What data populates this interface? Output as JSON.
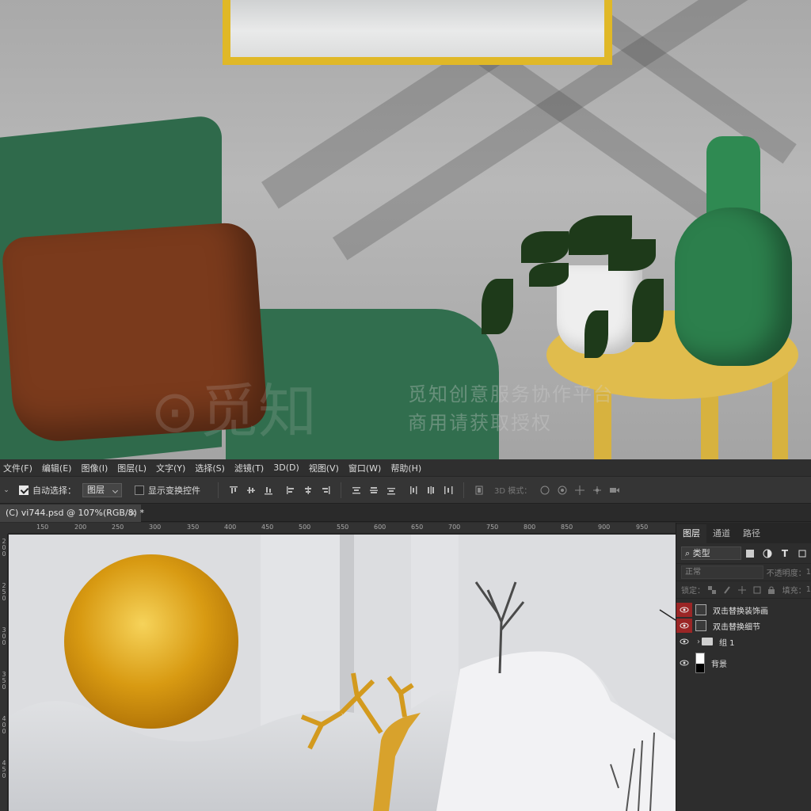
{
  "watermark": {
    "line1": "觅知创意服务协作平台",
    "line2": "商用请获取授权"
  },
  "menu": [
    "文件(F)",
    "编辑(E)",
    "图像(I)",
    "图层(L)",
    "文字(Y)",
    "选择(S)",
    "滤镜(T)",
    "3D(D)",
    "视图(V)",
    "窗口(W)",
    "帮助(H)"
  ],
  "options_bar": {
    "auto_select_label": "自动选择：",
    "auto_select_checked": true,
    "auto_select_value": "图层",
    "transform_controls_label": "显示变换控件",
    "transform_controls_checked": false,
    "mode3d_label": "3D 模式："
  },
  "document_tab": {
    "title": "(C) vi744.psd @ 107%(RGB/8) *",
    "close": "×"
  },
  "ruler": {
    "horizontal": [
      "150",
      "200",
      "250",
      "300",
      "350",
      "400",
      "450",
      "500",
      "550",
      "600",
      "650",
      "700",
      "750",
      "800",
      "850",
      "900",
      "950"
    ],
    "vertical": [
      "2",
      "0",
      "0",
      "2",
      "5",
      "0",
      "3",
      "0",
      "0",
      "3",
      "5",
      "0",
      "4",
      "0",
      "0",
      "4",
      "5",
      "0"
    ]
  },
  "layers_panel": {
    "tabs": [
      "图层",
      "通道",
      "路径"
    ],
    "active_tab": "图层",
    "filter_type": "类型",
    "blend_mode": "正常",
    "opacity_label": "不透明度：",
    "opacity_value": "1",
    "lock_label": "锁定：",
    "fill_label": "填充：",
    "fill_value": "1",
    "layers": [
      {
        "name": "双击替换装饰画",
        "kind": "smart",
        "visible": true,
        "highlight": true
      },
      {
        "name": "双击替换细节",
        "kind": "smart",
        "visible": true,
        "highlight": true
      },
      {
        "name": "组 1",
        "kind": "group",
        "visible": true,
        "highlight": false
      },
      {
        "name": "背景",
        "kind": "background",
        "visible": true,
        "highlight": false
      }
    ]
  },
  "colors": {
    "frame_gold": "#e0b827",
    "sofa_green": "#2f6a4b",
    "ps_panel": "#2d2d2d",
    "eye_highlight": "#9b2626"
  }
}
